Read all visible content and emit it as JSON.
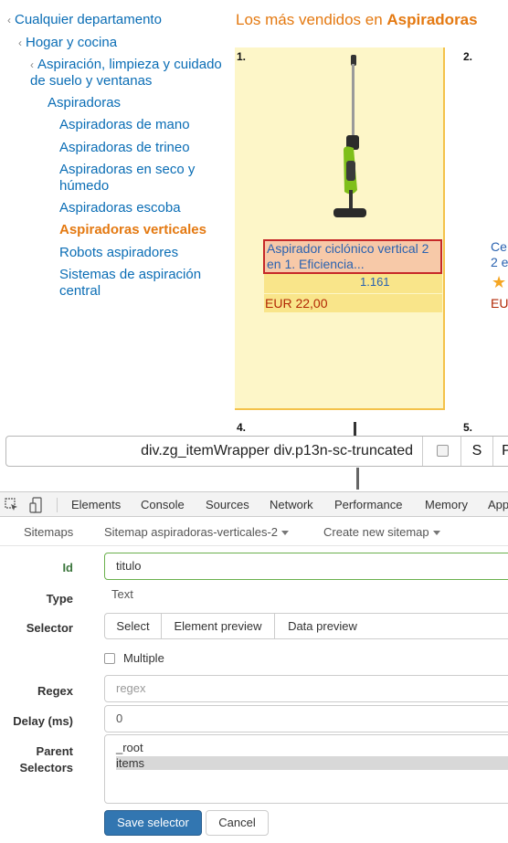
{
  "sidebar": {
    "items": [
      {
        "label": "Cualquier departamento",
        "chev": "‹"
      },
      {
        "label": "Hogar y cocina",
        "chev": "‹"
      },
      {
        "label": "Aspiración, limpieza y cuidado de suelo y ventanas",
        "chev": "‹"
      },
      {
        "label": "Aspiradoras"
      },
      {
        "label": "Aspiradoras de mano"
      },
      {
        "label": "Aspiradoras de trineo"
      },
      {
        "label": "Aspiradoras en seco y húmedo"
      },
      {
        "label": "Aspiradoras escoba"
      },
      {
        "label": "Aspiradoras verticales"
      },
      {
        "label": "Robots aspiradores"
      },
      {
        "label": "Sistemas de aspiración central"
      }
    ]
  },
  "bestsellers": {
    "prefix": "Los más vendidos en ",
    "category": "Aspiradoras"
  },
  "products": [
    {
      "rank": "1.",
      "title": "Aspirador ciclónico vertical 2 en 1. Eficiencia...",
      "reviews": "1.161",
      "price": "EUR 22,00"
    },
    {
      "rank": "2.",
      "title_line1": "Ce",
      "title_line2": "2 e",
      "price": "EU"
    }
  ],
  "ranks_lower": [
    "4.",
    "5."
  ],
  "selector_bar": {
    "selector": "div.zg_itemWrapper div.p13n-sc-truncated",
    "btn_s": "S",
    "btn_p": "P"
  },
  "devtools": {
    "tabs": [
      "Elements",
      "Console",
      "Sources",
      "Network",
      "Performance",
      "Memory",
      "App"
    ]
  },
  "sitemap_bar": {
    "sitemaps": "Sitemaps",
    "current": "Sitemap aspiradoras-verticales-2",
    "create": "Create new sitemap"
  },
  "form": {
    "id_label": "Id",
    "id_value": "titulo",
    "type_label": "Type",
    "type_value": "Text",
    "selector_label": "Selector",
    "selector_buttons": [
      "Select",
      "Element preview",
      "Data preview"
    ],
    "multiple_label": "Multiple",
    "regex_label": "Regex",
    "regex_placeholder": "regex",
    "delay_label": "Delay (ms)",
    "delay_value": "0",
    "parent_label_1": "Parent",
    "parent_label_2": "Selectors",
    "parent_options": [
      "_root",
      "items"
    ],
    "save": "Save selector",
    "cancel": "Cancel"
  },
  "colors": {
    "link": "#0a6db5",
    "orange": "#e47911",
    "highlight": "#fdf6c8",
    "selected_border": "#c62828",
    "save_btn": "#3276b1"
  }
}
